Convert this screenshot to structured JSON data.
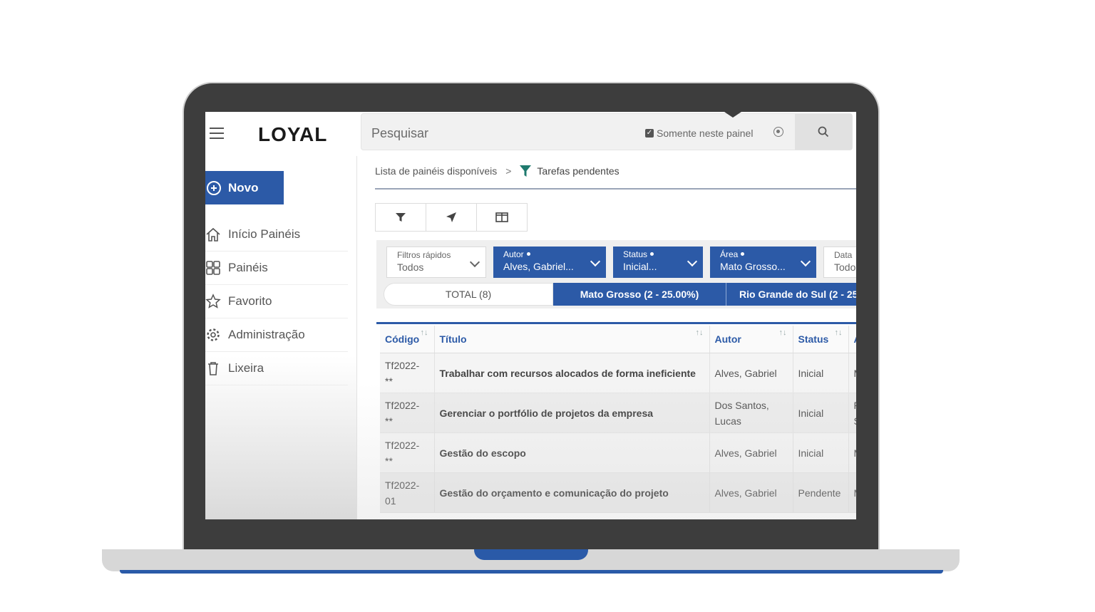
{
  "header": {
    "logo": "LOYAL",
    "search_placeholder": "Pesquisar",
    "only_panel_label": "Somente neste painel"
  },
  "sidebar": {
    "new_button": "Novo",
    "items": [
      {
        "label": "Início Painéis",
        "icon": "home-icon"
      },
      {
        "label": "Painéis",
        "icon": "grid-icon"
      },
      {
        "label": "Favorito",
        "icon": "star-icon"
      },
      {
        "label": "Administração",
        "icon": "gear-icon"
      },
      {
        "label": "Lixeira",
        "icon": "trash-icon"
      }
    ]
  },
  "breadcrumb": {
    "root": "Lista de painéis disponíveis",
    "separator": ">",
    "current": "Tarefas pendentes"
  },
  "toolbar": {
    "icons": [
      "filter-icon",
      "navigate-icon",
      "columns-icon"
    ]
  },
  "filters": [
    {
      "label": "Filtros rápidos",
      "value": "Todos",
      "style": "light"
    },
    {
      "label": "Autor",
      "value": "Alves, Gabriel...",
      "style": "blue"
    },
    {
      "label": "Status",
      "value": "Inicial...",
      "style": "blue"
    },
    {
      "label": "Área",
      "value": "Mato Grosso...",
      "style": "blue"
    },
    {
      "label": "Data",
      "value": "Todo",
      "style": "light"
    }
  ],
  "tabs": {
    "total": "TOTAL (8)",
    "active": "Mato Grosso (2 - 25.00%)",
    "other": "Rio Grande do Sul (2 - 25"
  },
  "table": {
    "columns": [
      "Código",
      "Título",
      "Autor",
      "Status",
      "A"
    ],
    "rows": [
      {
        "codigo": "Tf2022-\n**",
        "titulo": "Trabalhar com recursos alocados de forma ineficiente",
        "autor": "Alves, Gabriel",
        "status": "Inicial",
        "extra": "M"
      },
      {
        "codigo": "Tf2022-\n**",
        "titulo": "Gerenciar o portfólio de projetos da empresa",
        "autor": "Dos Santos, Lucas",
        "status": "Inicial",
        "extra": "R S"
      },
      {
        "codigo": "Tf2022-\n**",
        "titulo": "Gestão do escopo",
        "autor": "Alves, Gabriel",
        "status": "Inicial",
        "extra": "M"
      },
      {
        "codigo": "Tf2022-\n01",
        "titulo": "Gestão do orçamento e comunicação do projeto",
        "autor": "Alves, Gabriel",
        "status": "Pendente",
        "extra": "M"
      }
    ]
  },
  "colors": {
    "accent": "#2c5aa7",
    "frame": "#3d3d3d",
    "funnel": "#1f7a6e"
  }
}
